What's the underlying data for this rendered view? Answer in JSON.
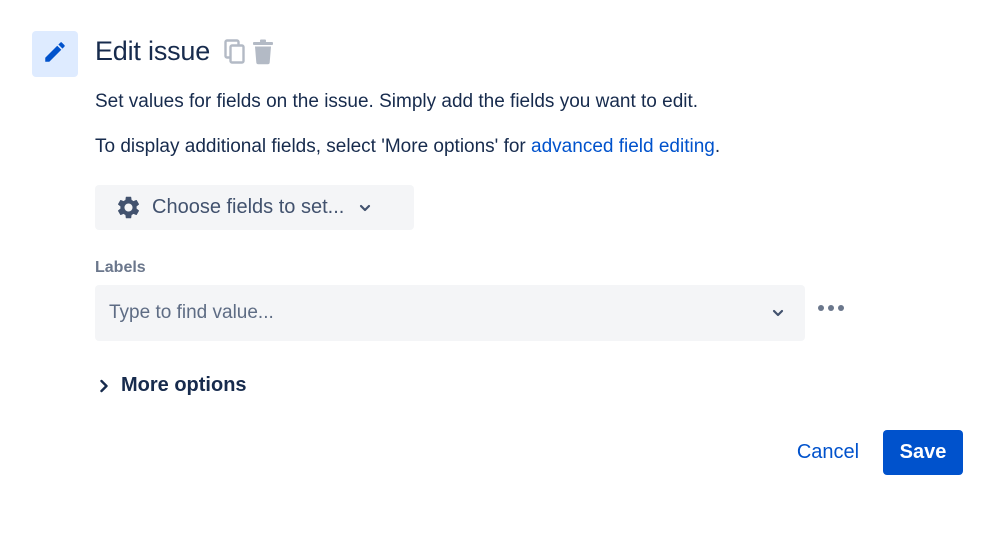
{
  "header": {
    "title": "Edit issue",
    "icons": {
      "main": "pencil-icon",
      "copy": "copy-icon",
      "delete": "trash-icon"
    }
  },
  "description": {
    "line1": "Set values for fields on the issue. Simply add the fields you want to edit.",
    "line2_prefix": "To display additional fields, select 'More options' for ",
    "line2_link": "advanced field editing",
    "line2_suffix": "."
  },
  "choose_fields": {
    "label": "Choose fields to set...",
    "icon": "gear-icon"
  },
  "labels_field": {
    "label": "Labels",
    "placeholder": "Type to find value..."
  },
  "more_options": {
    "label": "More options"
  },
  "footer": {
    "cancel_label": "Cancel",
    "save_label": "Save"
  },
  "colors": {
    "accent": "#0052CC",
    "icon_bg": "#DEEBFF",
    "text": "#172B4D",
    "muted": "#6B778C",
    "field_bg": "#F4F5F7"
  }
}
